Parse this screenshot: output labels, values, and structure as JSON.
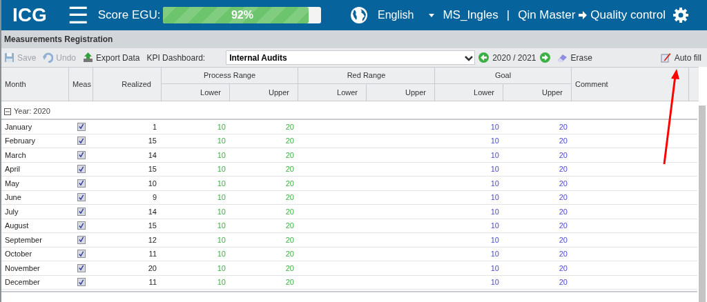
{
  "topbar": {
    "logo": "ICG",
    "menu_icon": "☰",
    "score_label": "Score EGU:",
    "score": {
      "text": "92%",
      "level": 0.92
    },
    "language": "English",
    "user": "MS_Ingles",
    "separator": "|",
    "breadcrumb": [
      "Qin Master",
      "Quality control"
    ]
  },
  "panel": {
    "title": "Measurements Registration"
  },
  "toolbar": {
    "save": {
      "label": "Save",
      "disabled": true
    },
    "undo": {
      "label": "Undo",
      "disabled": true
    },
    "export": {
      "label": "Export Data",
      "disabled": false
    },
    "kpi_label": "KPI Dashboard:",
    "kpi_value": "Internal Audits",
    "period": "2020 / 2021",
    "erase": "Erase",
    "auto_fill": "Auto fill"
  },
  "table": {
    "columns": [
      {
        "label": "Month"
      },
      {
        "label": "Meas"
      },
      {
        "label": "Realized"
      },
      {
        "label": "Process Range",
        "children": [
          "Lower",
          "Upper"
        ]
      },
      {
        "label": "Red Range",
        "children": [
          "Lower",
          "Upper"
        ]
      },
      {
        "label": "Goal",
        "children": [
          "Lower",
          "Upper"
        ]
      },
      {
        "label": "Comment"
      }
    ],
    "groups": [
      {
        "label": "Year: 2020",
        "expanded": true,
        "rows": [
          {
            "month": "January",
            "measured": true,
            "realized": "1",
            "process_lower": "10",
            "process_upper": "20",
            "goal_lower": "10",
            "goal_upper": "20"
          },
          {
            "month": "February",
            "measured": true,
            "realized": "15",
            "process_lower": "10",
            "process_upper": "20",
            "goal_lower": "10",
            "goal_upper": "20"
          },
          {
            "month": "March",
            "measured": true,
            "realized": "14",
            "process_lower": "10",
            "process_upper": "20",
            "goal_lower": "10",
            "goal_upper": "20"
          },
          {
            "month": "April",
            "measured": true,
            "realized": "15",
            "process_lower": "10",
            "process_upper": "20",
            "goal_lower": "10",
            "goal_upper": "20"
          },
          {
            "month": "May",
            "measured": true,
            "realized": "10",
            "process_lower": "10",
            "process_upper": "20",
            "goal_lower": "10",
            "goal_upper": "20"
          },
          {
            "month": "June",
            "measured": true,
            "realized": "9",
            "process_lower": "10",
            "process_upper": "20",
            "goal_lower": "10",
            "goal_upper": "20"
          },
          {
            "month": "July",
            "measured": true,
            "realized": "14",
            "process_lower": "10",
            "process_upper": "20",
            "goal_lower": "10",
            "goal_upper": "20"
          },
          {
            "month": "August",
            "measured": true,
            "realized": "15",
            "process_lower": "10",
            "process_upper": "20",
            "goal_lower": "10",
            "goal_upper": "20"
          },
          {
            "month": "September",
            "measured": true,
            "realized": "12",
            "process_lower": "10",
            "process_upper": "20",
            "goal_lower": "10",
            "goal_upper": "20"
          },
          {
            "month": "October",
            "measured": true,
            "realized": "11",
            "process_lower": "10",
            "process_upper": "20",
            "goal_lower": "10",
            "goal_upper": "20"
          },
          {
            "month": "November",
            "measured": true,
            "realized": "20",
            "process_lower": "10",
            "process_upper": "20",
            "goal_lower": "10",
            "goal_upper": "20"
          },
          {
            "month": "December",
            "measured": true,
            "realized": "11",
            "process_lower": "10",
            "process_upper": "20",
            "goal_lower": "10",
            "goal_upper": "20"
          }
        ]
      }
    ]
  }
}
